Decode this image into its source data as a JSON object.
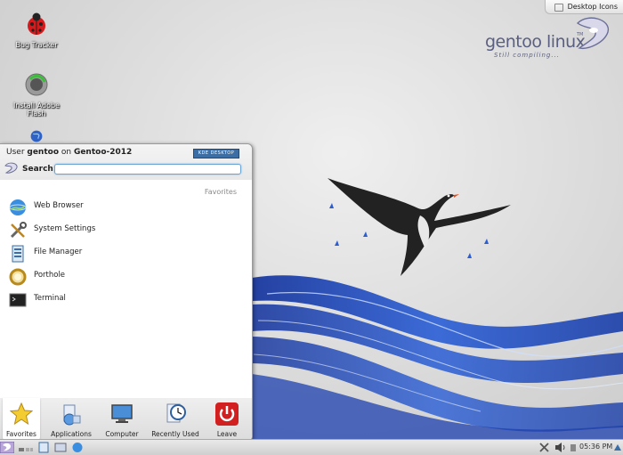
{
  "desktop": {
    "icons": [
      {
        "label": "Bug Tracker",
        "icon": "ladybug-icon"
      },
      {
        "label": "Install Adobe Flash",
        "icon": "flash-install-icon"
      },
      {
        "label": "",
        "icon": "globe-icon"
      }
    ],
    "desktop_icons_button": "Desktop Icons",
    "logo": {
      "word": "gentoo linux",
      "tm": "TM",
      "tagline": "Still compiling..."
    }
  },
  "launcher": {
    "user_prefix": "User ",
    "user_name": "gentoo",
    "user_mid": " on ",
    "host": "Gentoo-2012",
    "badge": "KDE DESKTOP",
    "search_label": "Search:",
    "search_value": "",
    "favorites_header": "Favorites",
    "favorites": [
      {
        "label": "Web Browser",
        "icon": "web-browser-icon"
      },
      {
        "label": "System Settings",
        "icon": "system-settings-icon"
      },
      {
        "label": "File Manager",
        "icon": "file-manager-icon"
      },
      {
        "label": "Porthole",
        "icon": "porthole-icon"
      },
      {
        "label": "Terminal",
        "icon": "terminal-icon"
      }
    ],
    "tabs": [
      {
        "label": "Favorites",
        "icon": "star-icon",
        "active": true
      },
      {
        "label": "Applications",
        "icon": "applications-icon",
        "active": false
      },
      {
        "label": "Computer",
        "icon": "computer-icon",
        "active": false
      },
      {
        "label": "Recently Used",
        "icon": "clock-icon",
        "active": false
      },
      {
        "label": "Leave",
        "icon": "power-icon",
        "active": false
      }
    ]
  },
  "taskbar": {
    "clock": "05:36 PM"
  },
  "colors": {
    "accent": "#3b6ea5",
    "ribbon_blue": "#1f49b8",
    "leave_red": "#d22020"
  }
}
